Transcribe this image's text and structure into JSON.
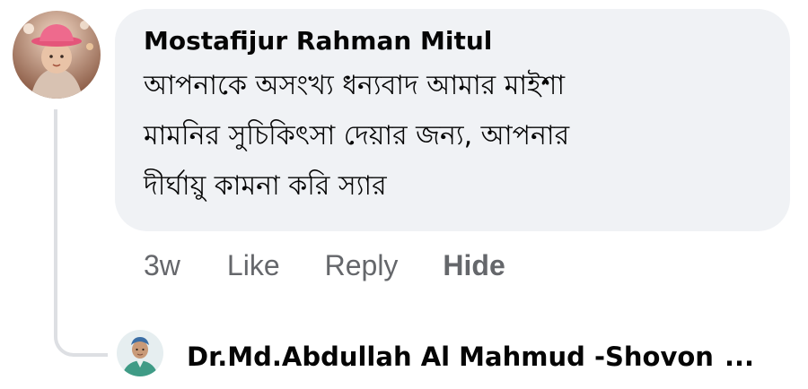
{
  "comment": {
    "author": "Mostafijur Rahman Mitul",
    "text_lines": [
      "আপনাকে অসংখ্য ধন্যবাদ আমার মাইশা",
      "মামনির সুচিকিৎসা দেয়ার জন্য,  আপনার",
      "দীর্ঘায়ু কামনা করি স্যার"
    ],
    "avatar_icon": "baby-avatar-photo",
    "bubble_color": "#f0f2f5"
  },
  "actions": {
    "age": "3w",
    "like": "Like",
    "reply": "Reply",
    "hide": "Hide"
  },
  "reply": {
    "author": "Dr.Md.Abdullah Al Mahmud -Shovon",
    "ellipsis": "...",
    "avatar_icon": "doctor-avatar-photo"
  },
  "colors": {
    "text": "#050505",
    "secondary_text": "#65676b",
    "thread_line": "#dddfe3"
  }
}
